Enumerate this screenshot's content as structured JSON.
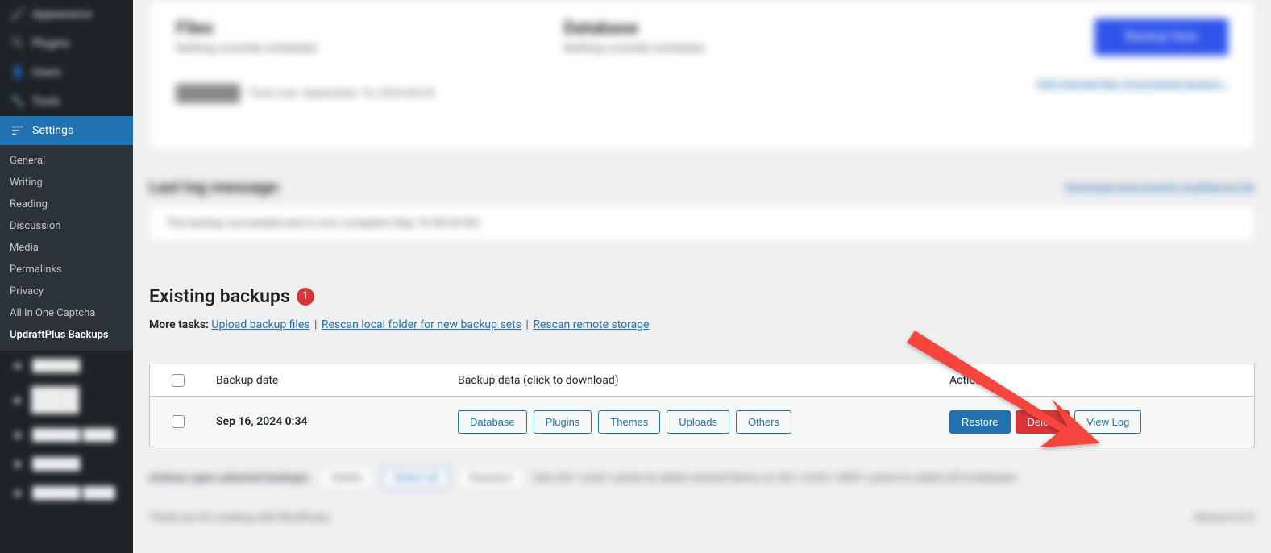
{
  "sidebar": {
    "topBlurred": [
      "Appearance",
      "Plugins",
      "Users",
      "Tools"
    ],
    "settingsLabel": "Settings",
    "submenu": [
      "General",
      "Writing",
      "Reading",
      "Discussion",
      "Media",
      "Permalinks",
      "Privacy",
      "All In One Captcha",
      "UpdraftPlus Backups"
    ],
    "submenuCurrent": "UpdraftPlus Backups",
    "bottomBlurred": [
      "Item",
      "Item",
      "Item",
      "Item",
      "Item"
    ]
  },
  "topPanel": {
    "filesLabel": "Files",
    "filesSub": "Nothing currently scheduled",
    "dbLabel": "Database",
    "dbSub": "Nothing currently scheduled",
    "time": "Time now: September 16, 2024 00:35",
    "backupNow": "Backup Now",
    "bottomLink": "Add changed files (incremental backup)…"
  },
  "logSection": {
    "heading": "Last log message:",
    "link": "Download most recently modified log file",
    "body": "The backup succeeded and is now complete (Sep 16 00:34:56)"
  },
  "existing": {
    "heading": "Existing backups",
    "count": "1"
  },
  "moreTasks": {
    "label": "More tasks:",
    "upload": "Upload backup files",
    "rescanLocal": "Rescan local folder for new backup sets",
    "rescanRemote": "Rescan remote storage"
  },
  "table": {
    "headers": {
      "date": "Backup date",
      "data": "Backup data (click to download)",
      "actions": "Actions"
    },
    "row": {
      "date": "Sep 16, 2024 0:34",
      "pills": [
        "Database",
        "Plugins",
        "Themes",
        "Uploads",
        "Others"
      ],
      "restore": "Restore",
      "delete": "Delete",
      "viewlog": "View Log"
    }
  },
  "bottomActions": {
    "label": "Actions upon selected backups:",
    "btn1": "Delete",
    "btn2": "Select all",
    "btn3": "Deselect",
    "hint": "Use ctrl / cmd + press to select several items, or ctrl / cmd + shift + press to select all in between"
  },
  "footer": {
    "left": "Thank you for creating with WordPress.",
    "right": "Version 6.6.2"
  }
}
